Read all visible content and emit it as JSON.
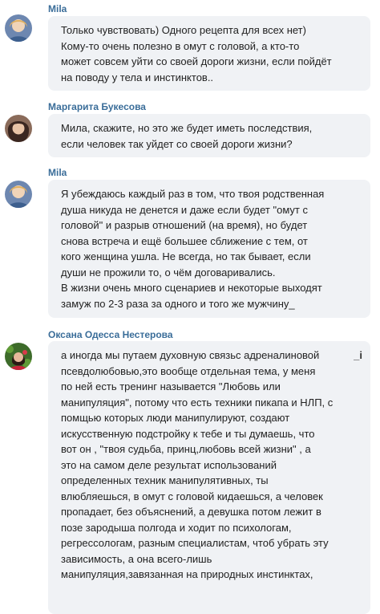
{
  "messages": [
    {
      "author": "Mila",
      "avatar": "avatar-mila",
      "lines": [
        "Только чувствовать) Одного рецепта для всех нет)",
        "Кому-то очень полезно в омут с головой, а кто-то",
        "может совсем уйти со своей дороги жизни, если пойдёт",
        "на поводу у тела и инстинктов.."
      ]
    },
    {
      "author": "Маргарита Букесова",
      "avatar": "avatar-margarita",
      "lines": [
        "Мила, скажите, но это же будет иметь последствия,",
        "если человек так уйдет со своей дороги жизни?"
      ]
    },
    {
      "author": "Mila",
      "avatar": "avatar-mila",
      "lines": [
        "Я убеждаюсь каждый раз в том, что твоя родственная",
        "душа никуда не денется и даже если будет \"омут с",
        "головой\" и разрыв отношений (на время), но будет",
        "снова встреча и ещё большее сближение с тем, от",
        "кого женщина ушла. Не всегда, но так бывает, если",
        "души не прожили то, о чём договаривались.",
        "В жизни очень много сценариев и некоторые выходят",
        "замуж по 2-3 раза за одного и того же мужчину_"
      ]
    },
    {
      "author": "Оксана Одесса Нестерова",
      "avatar": "avatar-oksana",
      "edit_mark": "_i",
      "lines": [
        "а иногда мы путаем духовную связьс адреналиновой",
        "псевдолюбовью,это вообще отдельная тема, у меня",
        "по ней есть тренинг называется \"Любовь или",
        "манипуляция\", потому что есть техники пикапа и НЛП, с",
        "помщью которых люди манипулируют, создают",
        "искусственную подстройку к тебе и ты думаешь, что",
        "вот он , \"твоя судьба, принц,любовь всей жизни\" , а",
        "это на самом деле результат использований",
        "определенных техник манипулятивных, ты",
        "влюбляешься, в омут с головой кидаешься, а человек",
        "пропадает, без объяснений, а девушка потом лежит в",
        "позе зародыша полгода и ходит по психологам,",
        "регрессологам, разным специалистам, чтоб убрать эту",
        "зависимость, а она всего-лишь",
        "манипуляция,завязанная на природных инстинктах,"
      ]
    }
  ]
}
